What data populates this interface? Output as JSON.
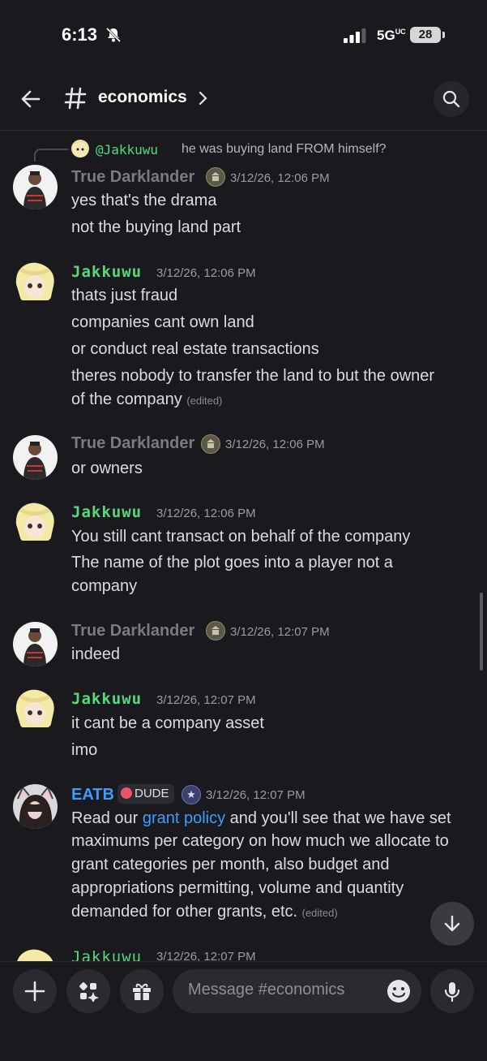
{
  "status": {
    "time": "6:13",
    "network": "5G",
    "network_sup": "UC",
    "battery": "28"
  },
  "header": {
    "channel": "economics"
  },
  "reply": {
    "mention": "@Jakkuwu",
    "text": "he was buying land FROM himself?"
  },
  "messages": [
    {
      "author": "True Darklander",
      "time": "3/12/26, 12:06 PM",
      "lines": [
        "yes that's the drama",
        "not the buying land part"
      ]
    },
    {
      "author": "Jakkuwu",
      "time": "3/12/26, 12:06 PM",
      "lines": [
        "thats just fraud",
        "companies cant own land",
        "or conduct real estate transactions",
        "theres nobody to transfer the land to but the owner",
        "of the company"
      ],
      "edited": "(edited)"
    },
    {
      "author": "True Darklander",
      "time": "3/12/26, 12:06 PM",
      "lines": [
        "or owners"
      ]
    },
    {
      "author": "Jakkuwu",
      "time": "3/12/26, 12:06 PM",
      "lines": [
        "You still cant transact on behalf of the company",
        "The name of the plot goes into a player not a",
        "company"
      ]
    },
    {
      "author": "True Darklander",
      "time": "3/12/26, 12:07 PM",
      "lines": [
        "indeed"
      ]
    },
    {
      "author": "Jakkuwu",
      "time": "3/12/26, 12:07 PM",
      "lines": [
        "it cant be a company asset",
        "imo"
      ]
    },
    {
      "author": "EATB",
      "tag": "DUDE",
      "time": "3/12/26, 12:07 PM",
      "pre": "Read our ",
      "link": "grant policy",
      "post": " and you'll see that we have set",
      "lines": [
        "maximums per category on how much we allocate to",
        "grant categories per month, also budget and",
        "appropriations permitting, volume and quantity",
        "demanded for other grants, etc."
      ],
      "edited": "(edited)"
    }
  ],
  "partial": {
    "author": "Jakkuwu",
    "time": "3/12/26, 12:07 PM"
  },
  "composer": {
    "placeholder": "Message #economics"
  },
  "colors": {
    "background": "#1a1a1e",
    "jakkuwu": "#56d97a",
    "darklander": "#7a7a80",
    "eatb": "#3b9eff",
    "link": "#3b9eff"
  }
}
